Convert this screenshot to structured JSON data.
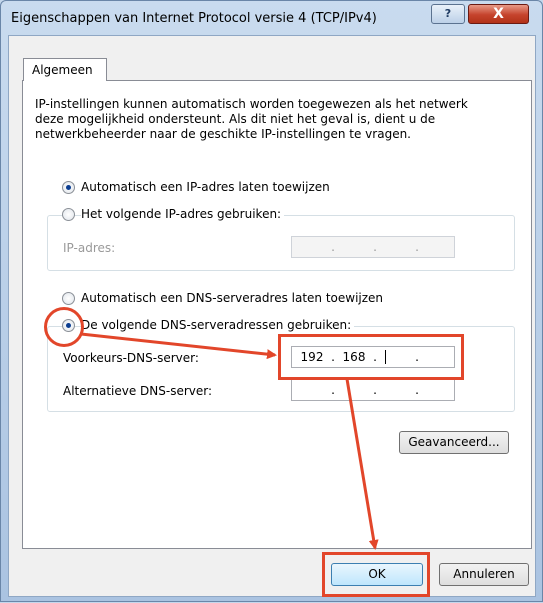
{
  "window": {
    "title": "Eigenschappen van Internet Protocol versie 4 (TCP/IPv4)",
    "help_label": "?",
    "close_label": "X"
  },
  "tabs": [
    {
      "label": "Algemeen"
    }
  ],
  "description": "IP-instellingen kunnen automatisch worden toegewezen als het netwerk deze mogelijkheid ondersteunt. Als dit niet het geval is, dient u de netwerkbeheerder naar de geschikte IP-instellingen te vragen.",
  "ip_section": {
    "auto_label": "Automatisch een IP-adres laten toewijzen",
    "auto_checked": true,
    "manual_label": "Het volgende IP-adres gebruiken:",
    "manual_checked": false,
    "ip_address_label": "IP-adres:",
    "ip_address_value": [
      "",
      "",
      "",
      ""
    ]
  },
  "dns_section": {
    "auto_label": "Automatisch een DNS-serveradres laten toewijzen",
    "auto_checked": false,
    "manual_label": "De volgende DNS-serveradressen gebruiken:",
    "manual_checked": true,
    "preferred_label": "Voorkeurs-DNS-server:",
    "preferred_value": [
      "192",
      "168",
      "",
      ""
    ],
    "alternate_label": "Alternatieve DNS-server:",
    "alternate_value": [
      "",
      "",
      "",
      ""
    ]
  },
  "advanced_button": "Geavanceerd...",
  "ok_button": "OK",
  "cancel_button": "Annuleren",
  "annotation_color": "#e2462a"
}
